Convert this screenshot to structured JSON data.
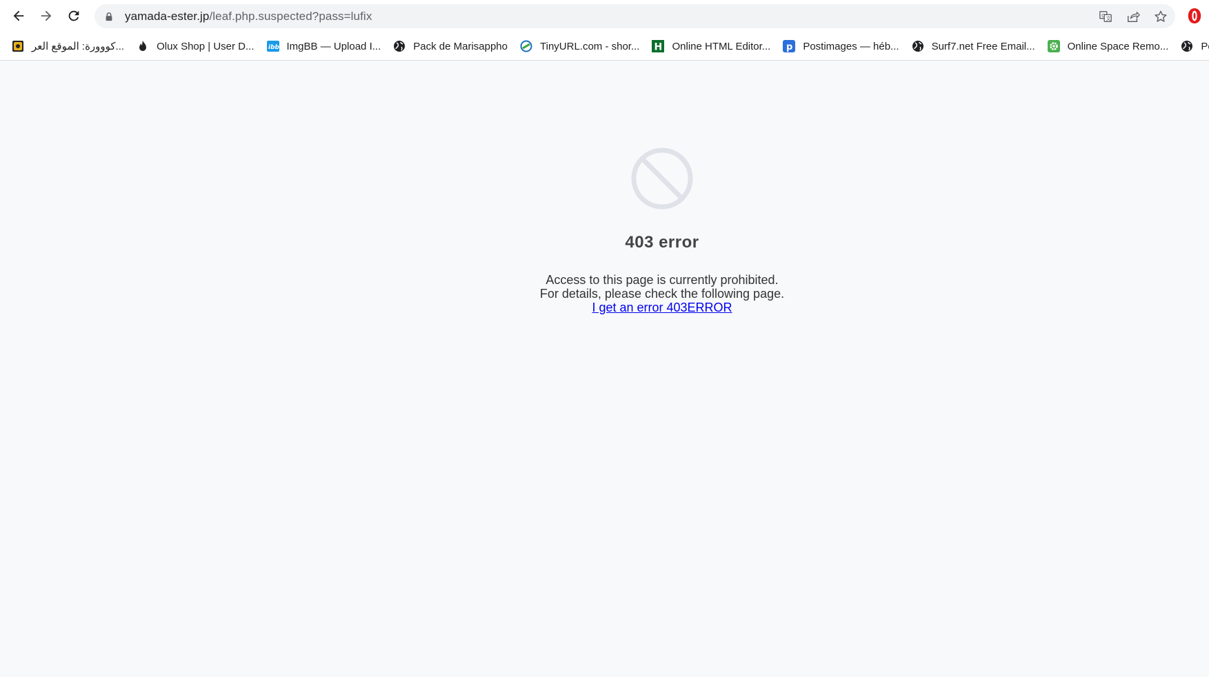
{
  "browser": {
    "url_host": "yamada-ester.jp",
    "url_path": "/leaf.php.suspected?pass=lufix"
  },
  "bookmarks": [
    {
      "label": "كووورة: الموقع العر...",
      "icon": "kooora-icon"
    },
    {
      "label": "Olux Shop | User D...",
      "icon": "flame-icon"
    },
    {
      "label": "ImgBB — Upload I...",
      "icon": "imgbb-icon"
    },
    {
      "label": "Pack de Marisappho",
      "icon": "globe-icon"
    },
    {
      "label": "TinyURL.com - shor...",
      "icon": "tinyurl-icon"
    },
    {
      "label": "Online HTML Editor...",
      "icon": "html-editor-icon"
    },
    {
      "label": "Postimages — héb...",
      "icon": "postimages-icon"
    },
    {
      "label": "Surf7.net Free Email...",
      "icon": "globe-icon"
    },
    {
      "label": "Online Space Remo...",
      "icon": "gear-icon"
    },
    {
      "label": "Pov",
      "icon": "globe-icon"
    }
  ],
  "page": {
    "title": "403 error",
    "line1": "Access to this page is currently prohibited.",
    "line2": "For details, please check the following page.",
    "link": "I get an error 403ERROR"
  },
  "colors": {
    "background": "#f8f9fb",
    "link": "#0000ee",
    "icon_gray": "#dfe2e8"
  }
}
